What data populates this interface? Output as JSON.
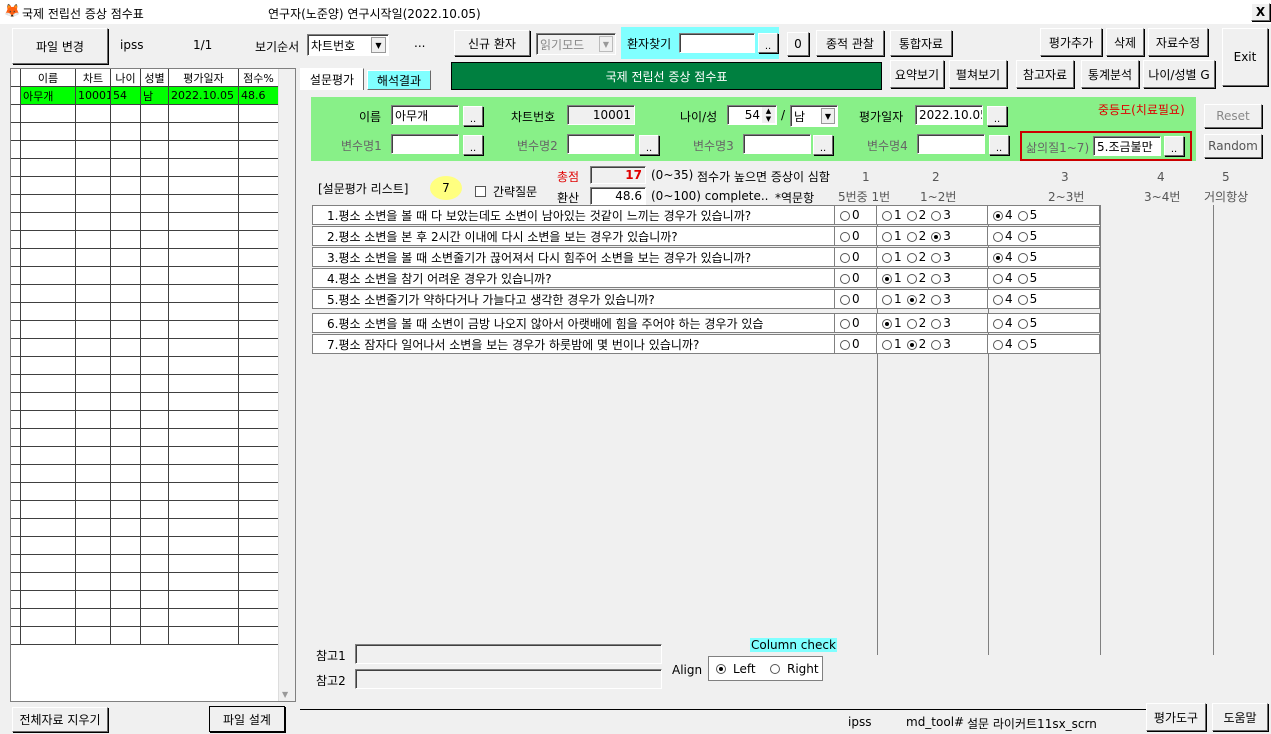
{
  "window": {
    "title": "국제 전립선 증상 점수표",
    "subtitle": "연구자(노준양) 연구시작일(2022.10.05)",
    "close": "X"
  },
  "toolbar": {
    "file_change": "파일 변경",
    "db_name": "ipss",
    "page": "1/1",
    "sort_label": "보기순서",
    "sort_value": "차트번호",
    "ellipsis": "...",
    "new_patient": "신규 환자",
    "read_mode": "읽기모드",
    "find_patient": "환자찾기",
    "find_value": "",
    "dots": "..",
    "zero_btn": "0",
    "accumulate": "종적 관찰",
    "integrated": "통합자료",
    "add_eval": "평가추가",
    "delete": "삭제",
    "edit_data": "자료수정",
    "exit": "Exit",
    "summary": "요약보기",
    "expand": "펼쳐보기",
    "reference": "참고자료",
    "stats": "통계분석",
    "age_sex": "나이/성별 G"
  },
  "grid": {
    "headers": [
      "",
      "이름",
      "차트",
      "나이",
      "성별",
      "평가일자",
      "점수%"
    ],
    "rows": [
      [
        "",
        "아무개",
        "10001",
        "54",
        "남",
        "2022.10.05",
        "48.6"
      ]
    ],
    "empty_rows": 30
  },
  "tabs": {
    "survey": "설문평가",
    "result": "해석결과",
    "banner": "국제 전립선 증상 점수표"
  },
  "patient": {
    "name_label": "이름",
    "name_value": "아무개",
    "chart_label": "차트번호",
    "chart_value": "10001",
    "age_label": "나이/성",
    "age_value": "54",
    "slash": "/",
    "sex_value": "남",
    "date_label": "평가일자",
    "date_value": "2022.10.05",
    "severity": "중등도(치료필요)",
    "var1": "변수명1",
    "var2": "변수명2",
    "var3": "변수명3",
    "var4": "변수명4",
    "qol_label": "삶의질1~7)",
    "qol_value": "5.조금불만",
    "reset": "Reset",
    "random": "Random"
  },
  "summary": {
    "list_label": "[설문평가 리스트]",
    "count": "7",
    "brief_label": "간략질문",
    "total_label": "총점",
    "total_value": "17",
    "total_range": "(0~35)",
    "total_note": "점수가 높으면 증상이 심함",
    "converted_label": "환산",
    "converted_value": "48.6",
    "converted_range": "(0~100) complete..",
    "reverse_note": "*역문항"
  },
  "scale": {
    "heads": [
      "1",
      "2",
      "3",
      "4",
      "5"
    ],
    "subs": [
      "5번중 1번",
      "1~2번",
      "2~3번",
      "3~4번",
      "거의항상"
    ]
  },
  "questions": [
    {
      "text": "1.평소 소변을 볼 때 다 보았는데도 소변이 남아있는 것같이 느끼는 경우가 있습니까?",
      "selected": 4
    },
    {
      "text": "2.평소 소변을 본 후 2시간 이내에 다시 소변을 보는 경우가 있습니까?",
      "selected": 3
    },
    {
      "text": "3.평소 소변을 볼 때 소변줄기가 끊어져서 다시 힘주어 소변을 보는 경우가 있습니까?",
      "selected": 4
    },
    {
      "text": "4.평소 소변을 참기 어려운 경우가 있습니까?",
      "selected": 1
    },
    {
      "text": "5.평소 소변줄기가 약하다거나 가늘다고 생각한 경우가 있습니까?",
      "selected": 2
    },
    {
      "text": "6.평소 소변을 볼 때 소변이 금방 나오지 않아서 아랫배에 힘을 주어야 하는 경우가 있습",
      "selected": 1
    },
    {
      "text": "7.평소 잠자다 일어나서 소변을 보는 경우가 하룻밤에 몇 번이나 있습니까?",
      "selected": 2
    }
  ],
  "options": [
    "0",
    "1",
    "2",
    "3",
    "4",
    "5"
  ],
  "notes": {
    "ref1": "참고1",
    "ref2": "참고2",
    "column_check": "Column check",
    "align_label": "Align",
    "left": "Left",
    "right": "Right"
  },
  "bottom": {
    "clear_all": "전체자료 지우기",
    "file_setup": "파일 설계",
    "status_db": "ipss",
    "status_tool": "md_tool#",
    "status_survey": "설문 라이커트11sx_scrn",
    "eval_tool": "평가도구",
    "help": "도움말"
  },
  "colors": {
    "green_panel": "#88f088",
    "banner": "#008040",
    "highlight_row": "#00ff00",
    "cyan": "#80ffff",
    "severity_red": "#e00000",
    "qol_border": "#cc0000"
  }
}
